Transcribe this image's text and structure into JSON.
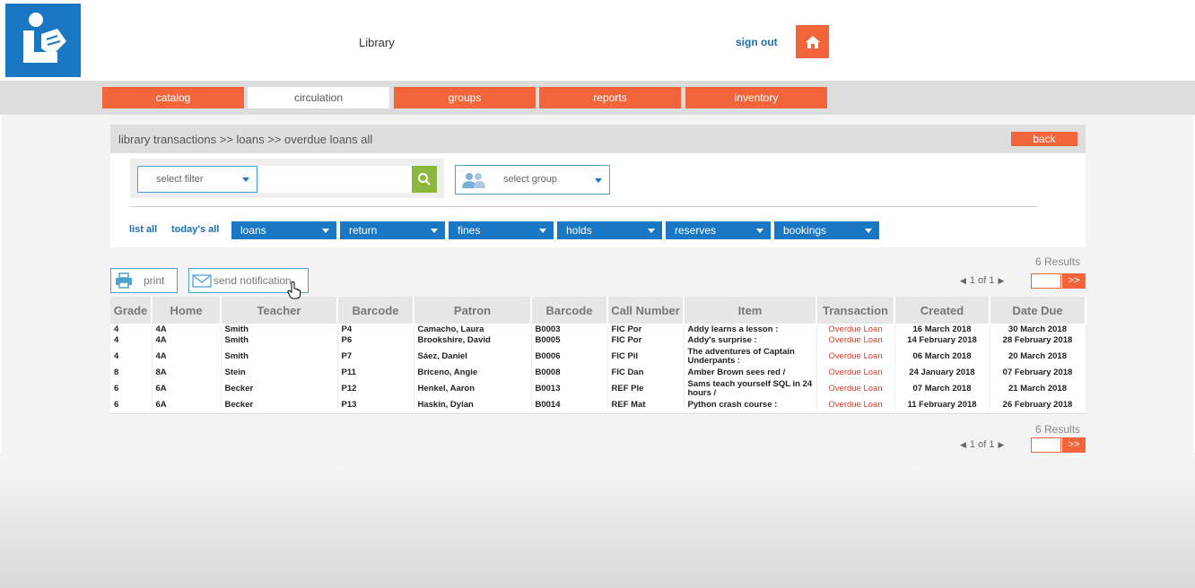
{
  "header": {
    "title": "Library",
    "sign_out": "sign out"
  },
  "nav": {
    "tabs": [
      "catalog",
      "circulation",
      "groups",
      "reports",
      "inventory"
    ],
    "active": "circulation"
  },
  "breadcrumb": "library transactions >> loans >> overdue loans all",
  "back_label": "back",
  "filter": {
    "select_filter": "select filter",
    "search_value": "",
    "select_group": "select group"
  },
  "links": {
    "list_all": "list all",
    "todays_all": "today's all"
  },
  "drop_tabs": [
    "loans",
    "return",
    "fines",
    "holds",
    "reserves",
    "bookings"
  ],
  "results": {
    "count_label": "6 Results",
    "page_label": "1 of 1",
    "go_label": ">>"
  },
  "tools": {
    "print": "print",
    "send_notification": "send notification"
  },
  "table": {
    "headers": [
      "Grade",
      "Home",
      "Teacher",
      "Barcode",
      "Patron",
      "Barcode",
      "Call Number",
      "Item",
      "Transaction",
      "Created",
      "Date Due"
    ],
    "rows": [
      [
        "4",
        "4A",
        "Smith",
        "P4",
        "Camacho, Laura",
        "B0003",
        "FIC Por",
        "Addy learns a lesson :",
        "Overdue Loan",
        "16 March 2018",
        "30 March 2018"
      ],
      [
        "4",
        "4A",
        "Smith",
        "P6",
        "Brookshire, David",
        "B0005",
        "FIC Por",
        "Addy's surprise :",
        "Overdue Loan",
        "14 February 2018",
        "28 February 2018"
      ],
      [
        "4",
        "4A",
        "Smith",
        "P7",
        "Sáez, Daniel",
        "B0006",
        "FIC Pil",
        "The adventures of Captain Underpants :",
        "Overdue Loan",
        "06 March 2018",
        "20 March 2018"
      ],
      [
        "8",
        "8A",
        "Stein",
        "P11",
        "Briceno, Angie",
        "B0008",
        "FIC Dan",
        "Amber Brown sees red /",
        "Overdue Loan",
        "24 January 2018",
        "07 February 2018"
      ],
      [
        "6",
        "6A",
        "Becker",
        "P12",
        "Henkel, Aaron",
        "B0013",
        "REF Ple",
        "Sams teach yourself SQL in 24 hours /",
        "Overdue Loan",
        "07 March 2018",
        "21 March 2018"
      ],
      [
        "6",
        "6A",
        "Becker",
        "P13",
        "Haskin, Dylan",
        "B0014",
        "REF Mat",
        "Python crash course :",
        "Overdue Loan",
        "11 February 2018",
        "26 February 2018"
      ]
    ]
  },
  "colors": {
    "accent": "#f2643a",
    "primary": "#1a77c4",
    "search_green": "#8ab83c",
    "transaction_red": "#d93b2b"
  }
}
